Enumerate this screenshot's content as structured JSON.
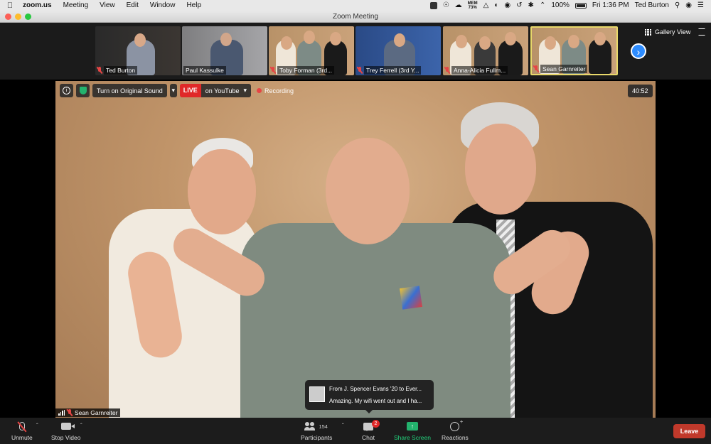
{
  "menubar": {
    "app": "zoom.us",
    "menus": [
      "Meeting",
      "View",
      "Edit",
      "Window",
      "Help"
    ],
    "mem_label": "MEM",
    "mem_value": "73%",
    "battery": "100%",
    "clock": "Fri 1:36 PM",
    "user": "Ted Burton"
  },
  "window": {
    "title": "Zoom Meeting"
  },
  "gallery": {
    "view_label": "Gallery View",
    "participants": [
      {
        "name": "Ted Burton",
        "muted": true,
        "active": false
      },
      {
        "name": "Paul Kassulke",
        "muted": false,
        "active": false
      },
      {
        "name": "Toby Forman (3rd...",
        "muted": true,
        "active": false
      },
      {
        "name": "Trey Ferrell (3rd Y...",
        "muted": true,
        "active": false
      },
      {
        "name": "Anna-Alicia Fullm...",
        "muted": true,
        "active": false
      },
      {
        "name": "Sean Garnreiter",
        "muted": true,
        "active": true
      }
    ]
  },
  "video": {
    "original_sound": "Turn on Original Sound",
    "live": "LIVE",
    "live_target": "on YouTube",
    "recording": "Recording",
    "timer": "40:52",
    "speaker": "Sean Garnreiter"
  },
  "chat_toast": {
    "from": "From J. Spencer Evans '20 to Ever...",
    "message": "Amazing. My wifi went out and I ha..."
  },
  "toolbar": {
    "unmute": "Unmute",
    "stop_video": "Stop Video",
    "participants": "Participants",
    "participant_count": "154",
    "chat": "Chat",
    "chat_badge": "2",
    "share_screen": "Share Screen",
    "reactions": "Reactions",
    "leave": "Leave"
  },
  "colors": {
    "accent_blue": "#2d8cff",
    "live_red": "#e02828",
    "share_green": "#23b26d",
    "leave_red": "#c0392b",
    "active_border": "#e9d96b"
  }
}
